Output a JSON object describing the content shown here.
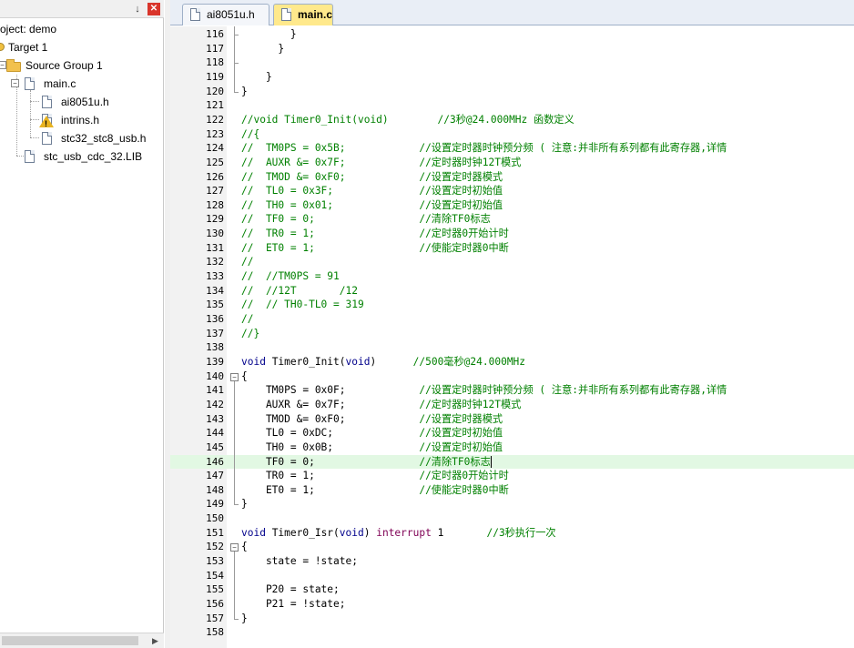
{
  "project_panel": {
    "pin_icon": "pin-icon",
    "close_icon": "close-icon",
    "tree": [
      {
        "label": "oject: demo"
      },
      {
        "label": "Target 1"
      },
      {
        "label": "Source Group 1"
      },
      {
        "label": "main.c"
      },
      {
        "label": "ai8051u.h"
      },
      {
        "label": "intrins.h"
      },
      {
        "label": "stc32_stc8_usb.h"
      },
      {
        "label": "stc_usb_cdc_32.LIB"
      }
    ]
  },
  "tabs": [
    {
      "label": "ai8051u.h",
      "active": false
    },
    {
      "label": "main.c",
      "active": true
    }
  ],
  "colors": {
    "comment": "#008000",
    "keyword": "#00008b",
    "interrupt_keyword": "#7f0055",
    "current_line": "#e2f8e3",
    "active_tab": "#ffe98c"
  },
  "editor": {
    "current_line_number": "146",
    "lines": [
      {
        "n": "116",
        "t": "        }"
      },
      {
        "n": "117",
        "t": "      }"
      },
      {
        "n": "118",
        "t": ""
      },
      {
        "n": "119",
        "t": "    }"
      },
      {
        "n": "120",
        "t": "}"
      },
      {
        "n": "121",
        "t": ""
      },
      {
        "n": "122",
        "t": "//void Timer0_Init(void)        //3秒@24.000MHz 函数定义"
      },
      {
        "n": "123",
        "t": "//{"
      },
      {
        "n": "124",
        "t": "//  TM0PS = 0x5B;            //设置定时器时钟预分频 ( 注意:并非所有系列都有此寄存器,详情"
      },
      {
        "n": "125",
        "t": "//  AUXR &= 0x7F;            //定时器时钟12T模式"
      },
      {
        "n": "126",
        "t": "//  TMOD &= 0xF0;            //设置定时器模式"
      },
      {
        "n": "127",
        "t": "//  TL0 = 0x3F;              //设置定时初始值"
      },
      {
        "n": "128",
        "t": "//  TH0 = 0x01;              //设置定时初始值"
      },
      {
        "n": "129",
        "t": "//  TF0 = 0;                 //清除TF0标志"
      },
      {
        "n": "130",
        "t": "//  TR0 = 1;                 //定时器0开始计时"
      },
      {
        "n": "131",
        "t": "//  ET0 = 1;                 //使能定时器0中断"
      },
      {
        "n": "132",
        "t": "//"
      },
      {
        "n": "133",
        "t": "//  //TM0PS = 91"
      },
      {
        "n": "134",
        "t": "//  //12T       /12"
      },
      {
        "n": "135",
        "t": "//  // TH0-TL0 = 319"
      },
      {
        "n": "136",
        "t": "//"
      },
      {
        "n": "137",
        "t": "//}"
      },
      {
        "n": "138",
        "t": ""
      },
      {
        "n": "139",
        "t": "void Timer0_Init(void)      //500毫秒@24.000MHz"
      },
      {
        "n": "140",
        "t": "{"
      },
      {
        "n": "141",
        "t": "    TM0PS = 0x0F;            //设置定时器时钟预分频 ( 注意:并非所有系列都有此寄存器,详情"
      },
      {
        "n": "142",
        "t": "    AUXR &= 0x7F;            //定时器时钟12T模式"
      },
      {
        "n": "143",
        "t": "    TMOD &= 0xF0;            //设置定时器模式"
      },
      {
        "n": "144",
        "t": "    TL0 = 0xDC;              //设置定时初始值"
      },
      {
        "n": "145",
        "t": "    TH0 = 0x0B;              //设置定时初始值"
      },
      {
        "n": "146",
        "t": "    TF0 = 0;                 //清除TF0标志"
      },
      {
        "n": "147",
        "t": "    TR0 = 1;                 //定时器0开始计时"
      },
      {
        "n": "148",
        "t": "    ET0 = 1;                 //使能定时器0中断"
      },
      {
        "n": "149",
        "t": "}"
      },
      {
        "n": "150",
        "t": ""
      },
      {
        "n": "151",
        "t": "void Timer0_Isr(void) interrupt 1       //3秒执行一次"
      },
      {
        "n": "152",
        "t": "{"
      },
      {
        "n": "153",
        "t": "    state = !state;"
      },
      {
        "n": "154",
        "t": ""
      },
      {
        "n": "155",
        "t": "    P20 = state;"
      },
      {
        "n": "156",
        "t": "    P21 = !state;"
      },
      {
        "n": "157",
        "t": "}"
      },
      {
        "n": "158",
        "t": ""
      }
    ]
  }
}
